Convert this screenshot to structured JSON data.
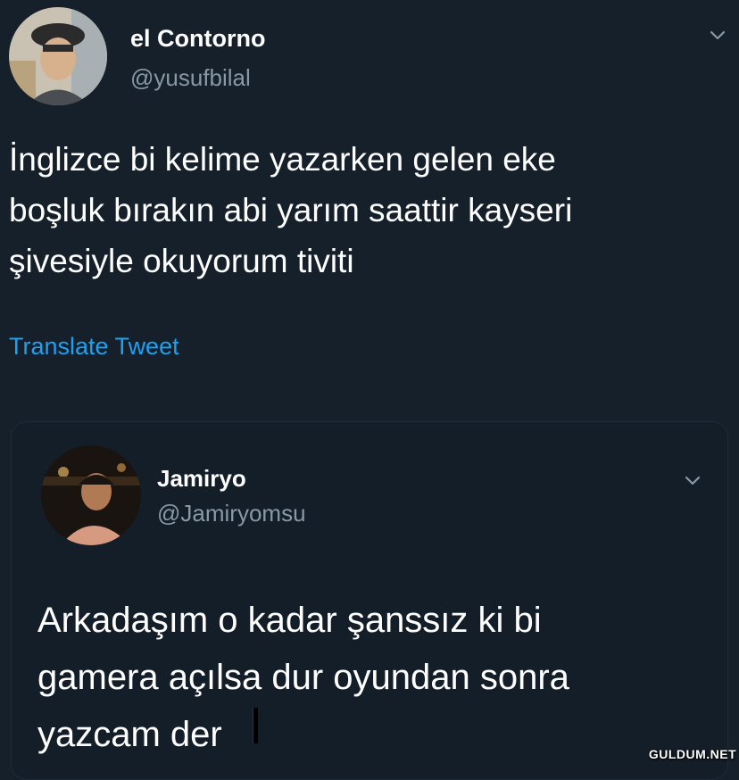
{
  "main_tweet": {
    "display_name": "el Contorno",
    "handle": "@yusufbilal",
    "text": "İnglizce bi kelime yazarken gelen eke\nboşluk bırakın abi yarım saattir kayseri\nşivesiyle okuyorum tiviti",
    "translate_label": "Translate Tweet",
    "avatar_icon": "user-avatar-icon",
    "menu_icon": "chevron-down-icon"
  },
  "quoted_tweet": {
    "display_name": "Jamiryo",
    "handle": "@Jamiryomsu",
    "text": "Arkadaşım o kadar şanssız ki bi\ngamera açılsa dur oyundan sonra\nyazcam der",
    "avatar_icon": "user-avatar-icon",
    "menu_icon": "chevron-down-icon"
  },
  "watermark": {
    "text": "GULDUM.NET"
  },
  "colors": {
    "background": "#15202b",
    "card_background": "#141e29",
    "text_primary": "#ffffff",
    "text_secondary": "#8899a6",
    "link": "#1da1f2"
  }
}
